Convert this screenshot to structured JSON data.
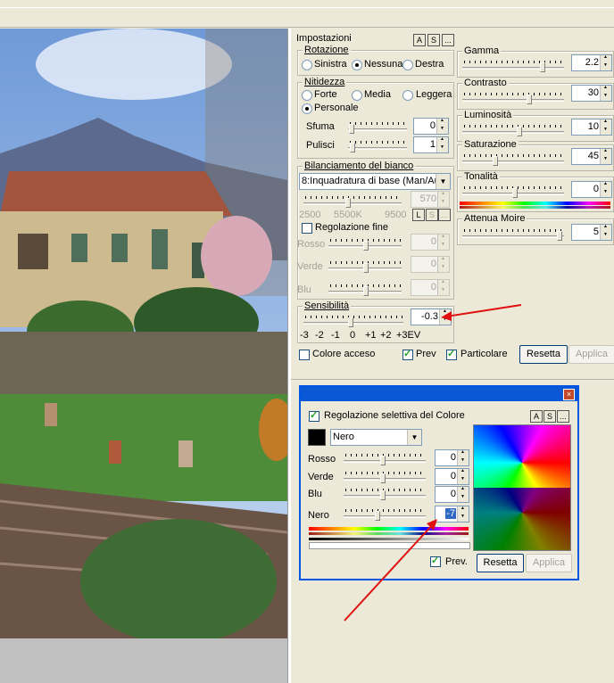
{
  "settings": {
    "title": "Impostazioni",
    "buttons": [
      "A",
      "S",
      "..."
    ],
    "rotation": {
      "label": "Rotazione",
      "options": [
        "Sinistra",
        "Nessuna",
        "Destra"
      ],
      "selected": "Nessuna"
    },
    "sharpness": {
      "label": "Nitidezza",
      "options": [
        "Forte",
        "Media",
        "Leggera",
        "Personale"
      ],
      "selected": "Personale",
      "sfuma": {
        "label": "Sfuma",
        "value": "0"
      },
      "pulisci": {
        "label": "Pulisci",
        "value": "1"
      }
    },
    "white_balance": {
      "label": "Bilanciamento del bianco",
      "mode": "8:Inquadratura di base (Man/Au",
      "value": "570",
      "scale": [
        "2500",
        "5500K",
        "9500"
      ],
      "buttons": [
        "L",
        "S",
        "..."
      ],
      "fine_label": "Regolazione fine",
      "fine_checked": false,
      "rows": [
        {
          "label": "Rosso",
          "value": "0"
        },
        {
          "label": "Verde",
          "value": "0"
        },
        {
          "label": "Blu",
          "value": "0"
        }
      ]
    },
    "sensitivity": {
      "label": "Sensibilità",
      "value": "-0.3",
      "scale": [
        "-3",
        "-2",
        "-1",
        "0",
        "+1",
        "+2",
        "+3EV"
      ]
    },
    "right": [
      {
        "label": "Gamma",
        "value": "2.2",
        "level": 0.79
      },
      {
        "label": "Contrasto",
        "value": "30",
        "level": 0.65
      },
      {
        "label": "Luminosità",
        "value": "10",
        "level": 0.55
      },
      {
        "label": "Saturazione",
        "value": "45",
        "level": 0.3
      },
      {
        "label": "Tonalità",
        "value": "0",
        "level": 0.5
      },
      {
        "label": "Attenua Moire",
        "value": "5",
        "level": 0.96
      }
    ],
    "bottom": {
      "colore_acceso": "Colore acceso",
      "prev": "Prev",
      "particolare": "Particolare",
      "reset": "Resetta",
      "apply": "Applica"
    }
  },
  "dialog": {
    "close": "×",
    "title_check": "Regolazione selettiva del Colore",
    "buttons": [
      "A",
      "S",
      "..."
    ],
    "color_name": "Nero",
    "rows": [
      {
        "label": "Rosso",
        "value": "0",
        "level": 0.45
      },
      {
        "label": "Verde",
        "value": "0",
        "level": 0.45
      },
      {
        "label": "Blu",
        "value": "0",
        "level": 0.45
      },
      {
        "label": "Nero",
        "value": "-7",
        "level": 0.38
      }
    ],
    "prev": "Prev.",
    "reset": "Resetta",
    "apply": "Applica"
  },
  "colors": {
    "accent": "#0a58d6",
    "arrow": "#e01010",
    "panel": "#ece9d8"
  }
}
